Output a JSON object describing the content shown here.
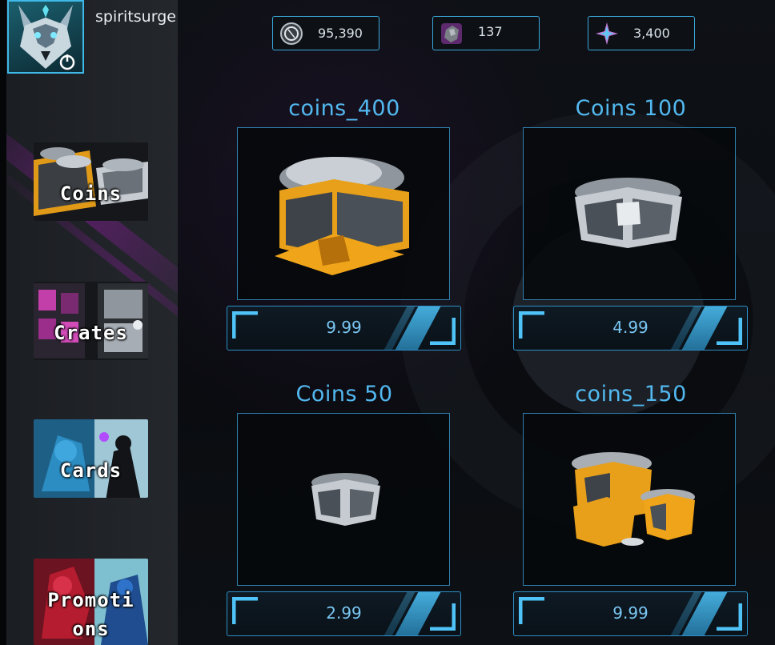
{
  "user": {
    "name": "spiritsurge"
  },
  "currencies": [
    {
      "name": "coins",
      "icon": "coin-icon",
      "value": "95,390"
    },
    {
      "name": "ore",
      "icon": "ore-icon",
      "value": "137"
    },
    {
      "name": "shards",
      "icon": "star-shard-icon",
      "value": "3,400"
    }
  ],
  "nav": [
    {
      "label": "Coins"
    },
    {
      "label": "Crates"
    },
    {
      "label": "Cards"
    },
    {
      "label_line1": "Promoti",
      "label_line2": "ons"
    }
  ],
  "products": [
    {
      "name": "coins_400",
      "price": "9.99"
    },
    {
      "name": "Coins 100",
      "price": "4.99"
    },
    {
      "name": "Coins 50",
      "price": "2.99"
    },
    {
      "name": "coins_150",
      "price": "9.99"
    }
  ],
  "colors": {
    "accent": "#52b8ef",
    "border": "#2f7fae",
    "gold": "#f0a419",
    "purple": "#8e1fa8"
  }
}
